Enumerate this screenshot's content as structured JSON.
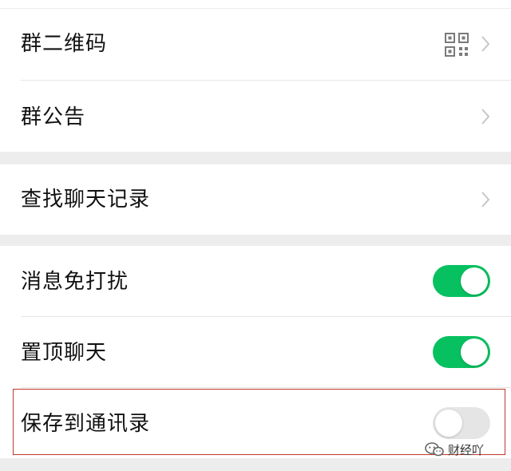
{
  "colors": {
    "toggle_on": "#07c160",
    "toggle_off": "#e5e5e5",
    "highlight_border": "#c0392b",
    "section_gap": "#ededed"
  },
  "settings": {
    "group_qr": {
      "label": "群二维码",
      "icon": "qr-code-icon"
    },
    "group_notice": {
      "label": "群公告"
    },
    "search_history": {
      "label": "查找聊天记录"
    },
    "mute": {
      "label": "消息免打扰",
      "enabled": true
    },
    "pin_top": {
      "label": "置顶聊天",
      "enabled": true
    },
    "save_contacts": {
      "label": "保存到通讯录",
      "enabled": false
    }
  },
  "watermark": {
    "icon": "wechat-icon",
    "text": "财经吖"
  }
}
